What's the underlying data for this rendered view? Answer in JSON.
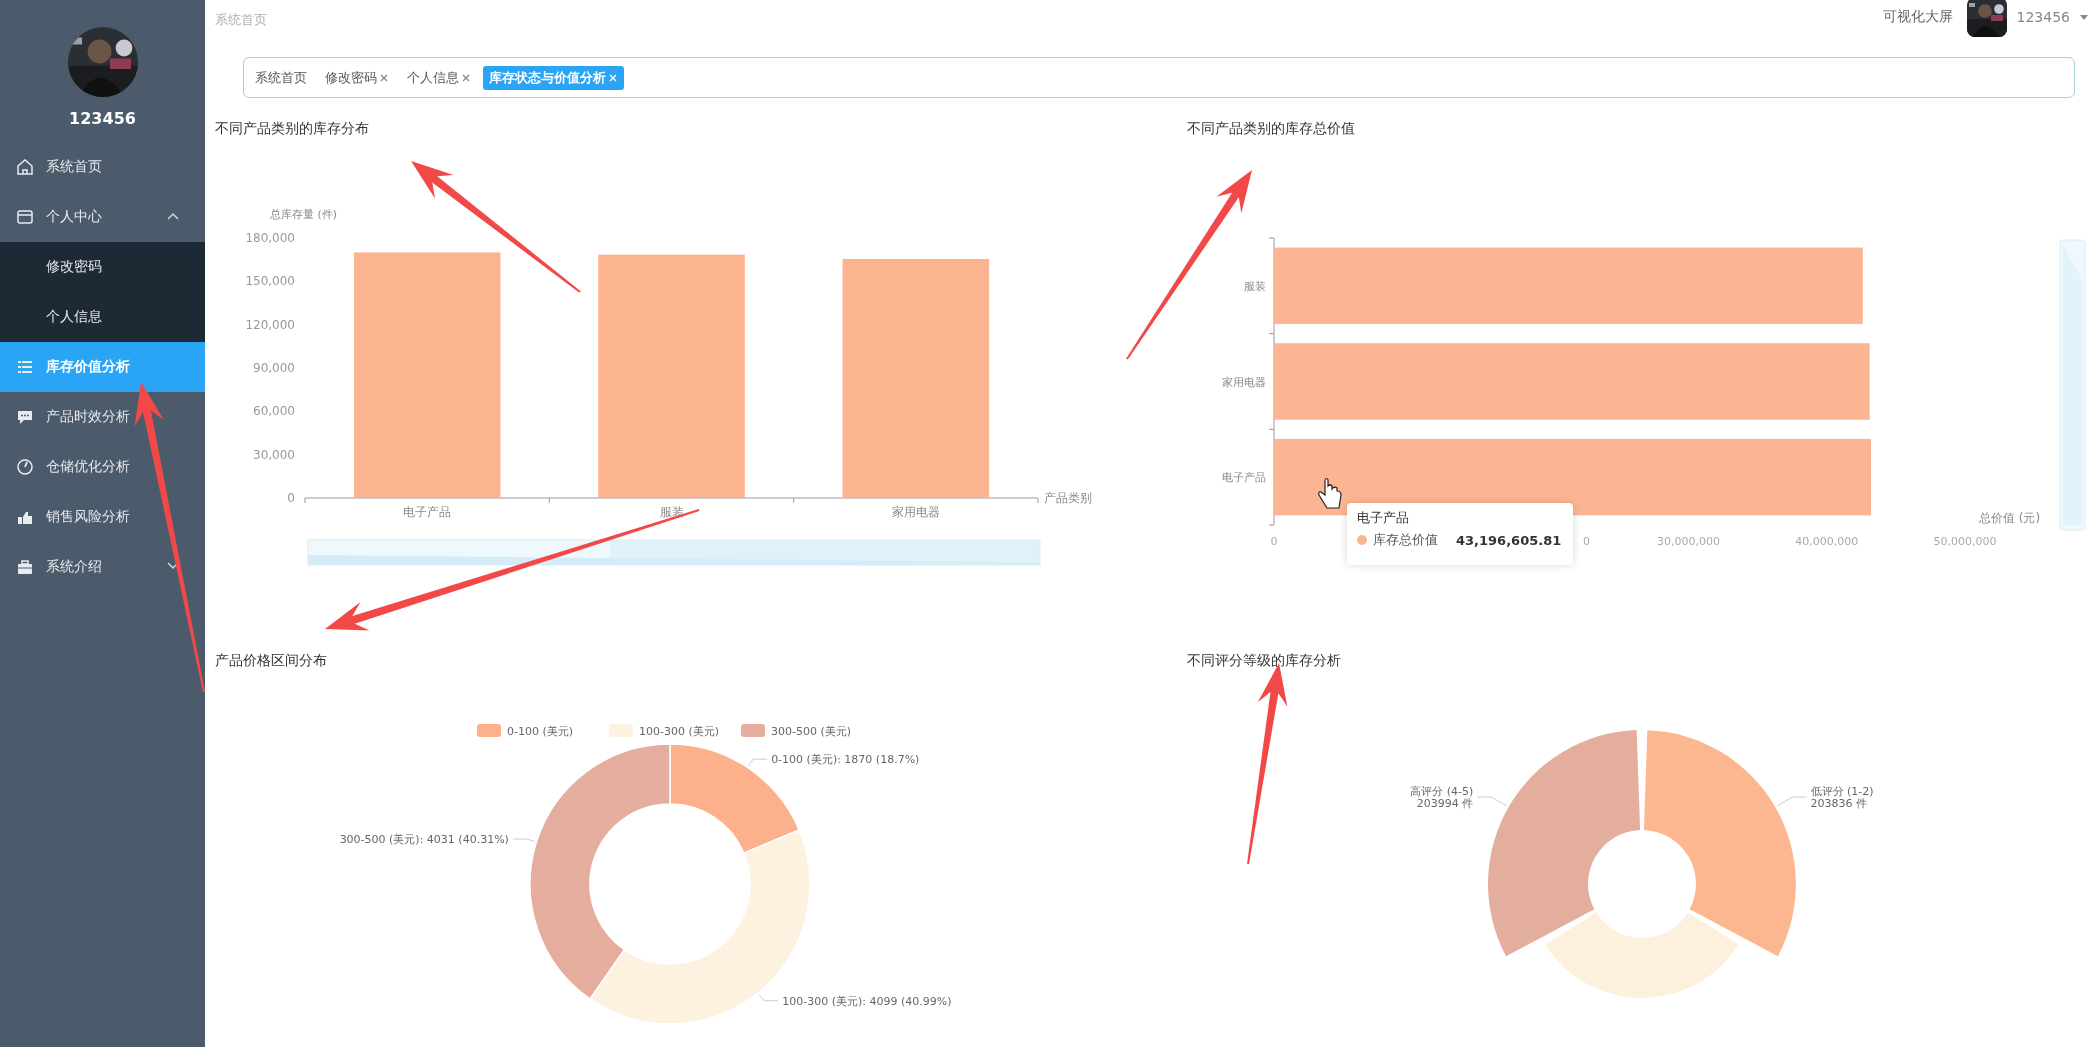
{
  "sidebar": {
    "username": "123456",
    "menu": [
      {
        "label": "系统首页",
        "kind": "link",
        "selected": false
      },
      {
        "label": "个人中心",
        "kind": "group",
        "selected": false,
        "expanded": true,
        "children": [
          {
            "label": "修改密码",
            "selected": false
          },
          {
            "label": "个人信息",
            "selected": false
          }
        ]
      },
      {
        "label": "库存价值分析",
        "kind": "link",
        "selected": true
      },
      {
        "label": "产品时效分析",
        "kind": "link",
        "selected": false
      },
      {
        "label": "仓储优化分析",
        "kind": "link",
        "selected": false
      },
      {
        "label": "销售风险分析",
        "kind": "link",
        "selected": false
      },
      {
        "label": "系统介绍",
        "kind": "group",
        "selected": false,
        "expanded": false
      }
    ]
  },
  "header": {
    "breadcrumb": "系统首页",
    "screen_link": "可视化大屏",
    "username": "123456"
  },
  "tabs": [
    {
      "label": "系统首页",
      "selected": false,
      "closable": false
    },
    {
      "label": "修改密码",
      "selected": false,
      "closable": true
    },
    {
      "label": "个人信息",
      "selected": false,
      "closable": true
    },
    {
      "label": "库存状态与价值分析",
      "selected": true,
      "closable": true
    }
  ],
  "panels": [
    {
      "title": "不同产品类别的库存分布",
      "chart_data": {
        "type": "bar",
        "orientation": "vertical",
        "categories": [
          "电子产品",
          "服装",
          "家用电器"
        ],
        "ylabel": "总库存量 (件)",
        "xlabel": "产品类别",
        "ylim": [
          0,
          180000
        ],
        "yticks": [
          {
            "value": 0,
            "label": "0"
          },
          {
            "value": 30000,
            "label": "30,000"
          },
          {
            "value": 60000,
            "label": "60,000"
          },
          {
            "value": 90000,
            "label": "90,000"
          },
          {
            "value": 120000,
            "label": "120,000"
          },
          {
            "value": 150000,
            "label": "150,000"
          },
          {
            "value": 180000,
            "label": "180,000"
          }
        ],
        "series": [
          {
            "color": "#fcb390",
            "values": [
              170000,
              168500,
              165500
            ]
          }
        ]
      }
    },
    {
      "title": "不同产品类别的库存总价值",
      "chart_data": {
        "type": "bar",
        "orientation": "horizontal",
        "categories": [
          "服装",
          "家用电器",
          "电子产品"
        ],
        "xlabel": "总价值 (元)",
        "xlim": [
          0,
          50000000
        ],
        "xticks": [
          {
            "value": 0,
            "label": "0"
          },
          {
            "value": 30000000,
            "label": "30,000,000"
          },
          {
            "value": 40000000,
            "label": "40,000,000"
          },
          {
            "value": 50000000,
            "label": "50,000,000"
          }
        ],
        "series": [
          {
            "name": "库存总价值",
            "color": "#fcb592",
            "values": [
              42600000,
              43100000,
              43200000
            ]
          }
        ]
      },
      "axis_fragment": "0",
      "tooltip": {
        "title": "电子产品",
        "value": "43,196,605.81",
        "color": "#fcb592"
      }
    },
    {
      "title": "产品价格区间分布",
      "chart_data": {
        "type": "donut",
        "legend": true,
        "categories": [
          "0-100 (美元)",
          "100-300 (美元)",
          "300-500 (美元)"
        ],
        "values": [
          1870,
          4099,
          4031
        ],
        "colors": [
          "#fcb08c",
          "#fdf1df",
          "#e4ad9e"
        ],
        "value_labels": [
          "0-100 (美元): 1870 (18.7%)",
          "100-300 (美元): 4099 (40.99%)",
          "300-500 (美元): 4031 (40.31%)"
        ]
      }
    },
    {
      "title": "不同评分等级的库存分析",
      "chart_data": {
        "type": "donut",
        "values": [
          203836,
          null,
          203994
        ],
        "colors": [
          "#fcb690",
          "#fdf0dc",
          "#e4ae9e"
        ],
        "value_labels": [
          "低评分 (1-2)\n203836 件",
          null,
          "高评分 (4-5)\n203994 件"
        ]
      }
    }
  ]
}
